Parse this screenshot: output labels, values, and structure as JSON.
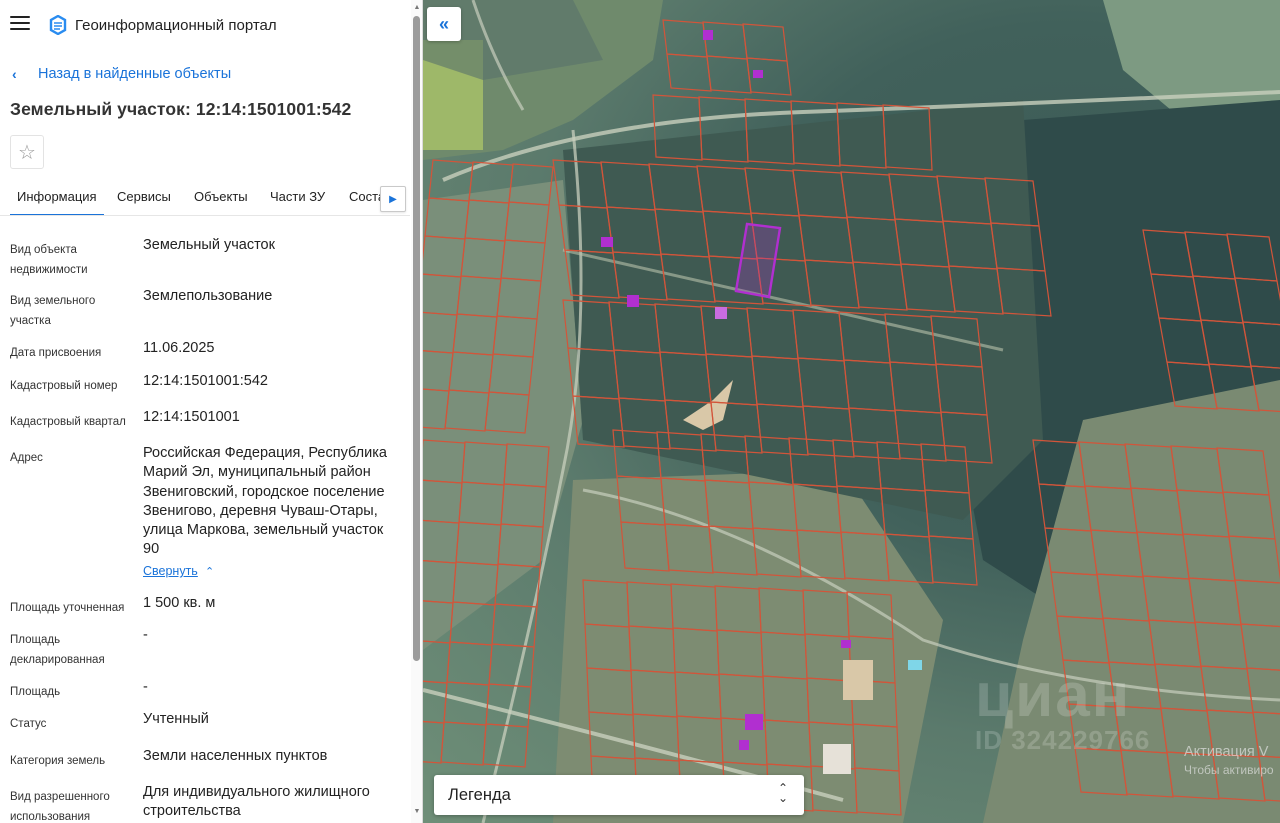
{
  "header": {
    "app_title": "Геоинформационный портал"
  },
  "nav": {
    "back_label": "Назад в найденные объекты"
  },
  "object": {
    "title": "Земельный участок: 12:14:1501001:542"
  },
  "tabs": [
    {
      "label": "Информация",
      "active": true
    },
    {
      "label": "Сервисы",
      "active": false
    },
    {
      "label": "Объекты",
      "active": false
    },
    {
      "label": "Части ЗУ",
      "active": false
    },
    {
      "label": "Соста",
      "active": false
    }
  ],
  "properties": [
    {
      "label_lines": [
        "Вид объекта",
        "недвижимости"
      ],
      "value_lines": [
        "Земельный участок"
      ]
    },
    {
      "label_lines": [
        "Вид земельного",
        "участка"
      ],
      "value_lines": [
        "Землепользование"
      ]
    },
    {
      "label_lines": [
        "Дата присвоения"
      ],
      "value_lines": [
        "11.06.2025"
      ]
    },
    {
      "label_lines": [
        "Кадастровый номер"
      ],
      "value_lines": [
        "12:14:1501001:542"
      ]
    },
    {
      "label_lines": [
        "Кадастровый квартал"
      ],
      "value_lines": [
        "12:14:1501001"
      ]
    },
    {
      "label_lines": [
        "Адрес"
      ],
      "value_lines": [
        "Российская Федерация, Республика",
        "Марий Эл, муниципальный район",
        "Звениговский, городское поселение",
        "Звенигово, деревня Чуваш-Отары,",
        "улица Маркова, земельный участок",
        "90"
      ]
    },
    {
      "label_lines": [
        "Площадь уточненная"
      ],
      "value_lines": [
        "1 500 кв. м"
      ]
    },
    {
      "label_lines": [
        "Площадь",
        "декларированная"
      ],
      "value_lines": [
        "-"
      ]
    },
    {
      "label_lines": [
        "Площадь"
      ],
      "value_lines": [
        "-"
      ]
    },
    {
      "label_lines": [
        "Статус"
      ],
      "value_lines": [
        "Учтенный"
      ]
    },
    {
      "label_lines": [
        "Категория земель"
      ],
      "value_lines": [
        "Земли населенных пунктов"
      ]
    },
    {
      "label_lines": [
        "Вид разрешенного",
        "использования"
      ],
      "value_lines": [
        "Для индивидуального жилищного",
        "строительства"
      ]
    }
  ],
  "address_toggle": {
    "label": "Свернуть"
  },
  "map": {
    "legend_label": "Легенда",
    "watermark": "циан",
    "watermark_id": "ID 324229766",
    "activation_title": "Активация V",
    "activation_subtitle": "Чтобы активиро",
    "parcel_stroke_color": "#d2553a",
    "selected_parcel_color": "#b12fd0"
  },
  "colors": {
    "accent": "#1a73d9"
  }
}
